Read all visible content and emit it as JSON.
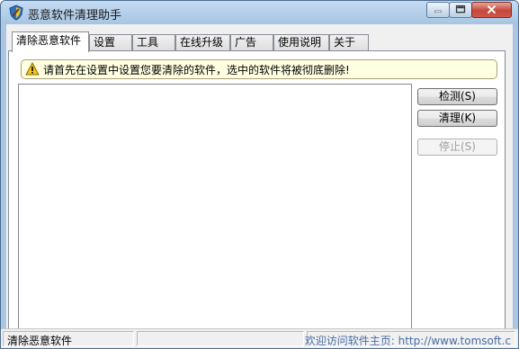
{
  "window": {
    "title": "恶意软件清理助手",
    "icon": "shield-broom-icon",
    "controls": [
      "minimize-icon",
      "maximize-icon",
      "close-icon"
    ]
  },
  "tabs": [
    {
      "label": "清除恶意软件",
      "active": true
    },
    {
      "label": "设置",
      "active": false
    },
    {
      "label": "工具",
      "active": false
    },
    {
      "label": "在线升级",
      "active": false
    },
    {
      "label": "广告",
      "active": false
    },
    {
      "label": "使用说明",
      "active": false
    },
    {
      "label": "关于",
      "active": false
    }
  ],
  "warning": {
    "icon": "warning-icon",
    "text": "请首先在设置中设置您要清除的软件，选中的软件将被彻底删除!"
  },
  "buttons": {
    "detect": "检测(S)",
    "clean": "清理(K)",
    "stop": "停止(S)"
  },
  "status": {
    "left": "清除恶意软件",
    "right": "欢迎访问软件主页: http://www.tomsoft.c"
  },
  "colors": {
    "titlebar": "#a6c4e2",
    "close_button": "#c4473a",
    "warning_bg": "#ffffe1",
    "link_text": "#4a6fa5"
  }
}
